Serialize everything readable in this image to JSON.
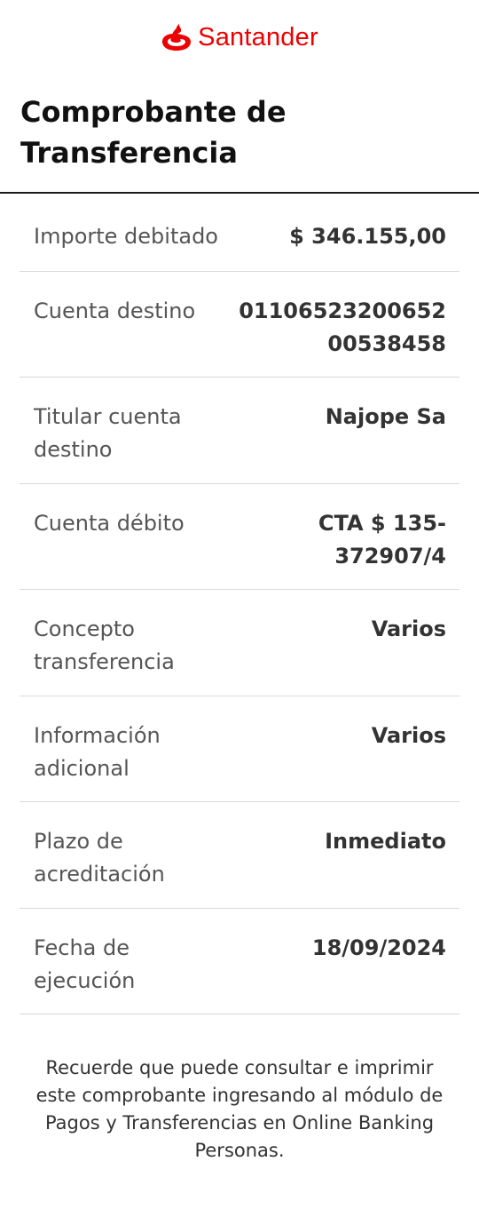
{
  "brand": {
    "name": "Santander",
    "color": "#ec0000",
    "icon": "santander-flame-icon"
  },
  "page": {
    "title": "Comprobante de Transferencia"
  },
  "details": [
    {
      "label": "Importe debitado",
      "value": "$ 346.155,00"
    },
    {
      "label": "Cuenta destino",
      "value": "0110652320065200538458"
    },
    {
      "label": "Titular cuenta destino",
      "value": "Najope Sa"
    },
    {
      "label": "Cuenta débito",
      "value": "CTA $ 135-372907/4"
    },
    {
      "label": "Concepto transferencia",
      "value": "Varios"
    },
    {
      "label": "Información adicional",
      "value": "Varios"
    },
    {
      "label": "Plazo de acreditación",
      "value": "Inmediato"
    },
    {
      "label": "Fecha de ejecución",
      "value": "18/09/2024"
    }
  ],
  "footer": {
    "note": "Recuerde que puede consultar e imprimir este comprobante ingresando al módulo de Pagos y Transferencias en Online Banking Personas."
  }
}
